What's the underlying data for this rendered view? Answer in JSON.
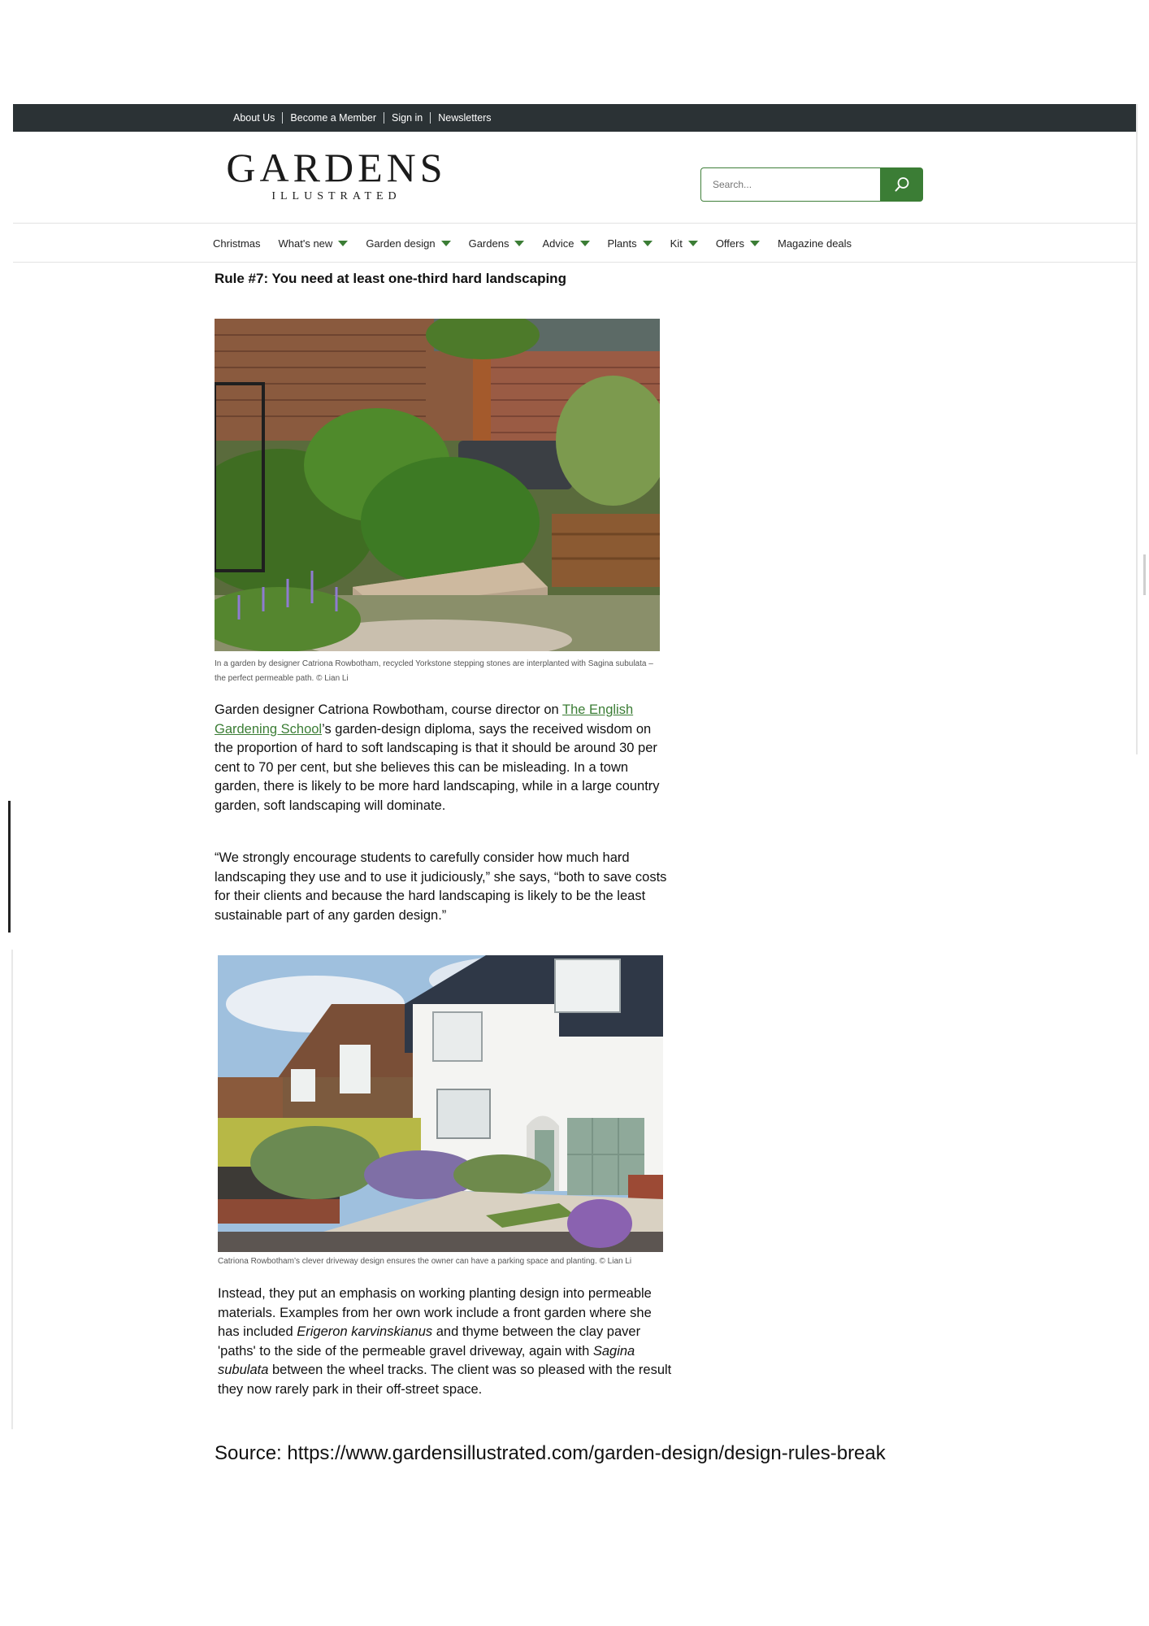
{
  "topbar": {
    "links": [
      "About Us",
      "Become a Member",
      "Sign in",
      "Newsletters"
    ]
  },
  "logo": {
    "main": "GARDENS",
    "sub": "ILLUSTRATED"
  },
  "search": {
    "placeholder": "Search...",
    "icon": "search-icon"
  },
  "nav": {
    "items": [
      {
        "label": "Christmas",
        "dropdown": false
      },
      {
        "label": "What's new",
        "dropdown": true
      },
      {
        "label": "Garden design",
        "dropdown": true
      },
      {
        "label": "Gardens",
        "dropdown": true
      },
      {
        "label": "Advice",
        "dropdown": true
      },
      {
        "label": "Plants",
        "dropdown": true
      },
      {
        "label": "Kit",
        "dropdown": true
      },
      {
        "label": "Offers",
        "dropdown": true
      },
      {
        "label": "Magazine deals",
        "dropdown": false
      }
    ]
  },
  "article": {
    "heading": "Rule #7: You need at least one-third hard landscaping",
    "photo1_caption": "In a garden by designer Catriona Rowbotham, recycled Yorkstone stepping stones are interplanted with Sagina subulata – the perfect permeable path. © Lian Li",
    "para1_start": "Garden designer Catriona Rowbotham, course director on ",
    "para1_link": "The English Gardening School",
    "para1_rest": "’s garden-design diploma, says the received wisdom on the proportion of hard to soft landscaping is that it should be around 30 per cent to 70 per cent, but she believes this can be misleading. In a town garden, there is likely to be more hard landscaping, while in a large country garden, soft landscaping will dominate.",
    "para2": "“We strongly encourage students to carefully consider how much hard landscaping they use and to use it judiciously,” she says, “both to save costs for their clients and because the hard landscaping is likely to be the least sustainable part of any garden design.”",
    "photo2_caption": "Catriona Rowbotham’s clever driveway design ensures the owner can have a parking space and planting. © Lian Li",
    "para3_a": "Instead, they put an emphasis on working planting design into permeable materials. Examples from her own work include a front garden where she has included ",
    "para3_em1": "Erigeron karvinskianus",
    "para3_b": " and thyme between the clay paver 'paths' to the side of the permeable gravel driveway, again with ",
    "para3_em2": "Sagina subulata",
    "para3_c": " between the wheel tracks. The client was so pleased with the result they now rarely park in their off-street space."
  },
  "source": "Source: https://www.gardensillustrated.com/garden-design/design-rules-break",
  "colors": {
    "topbar": "#2b3235",
    "accent": "#3b7d35"
  }
}
